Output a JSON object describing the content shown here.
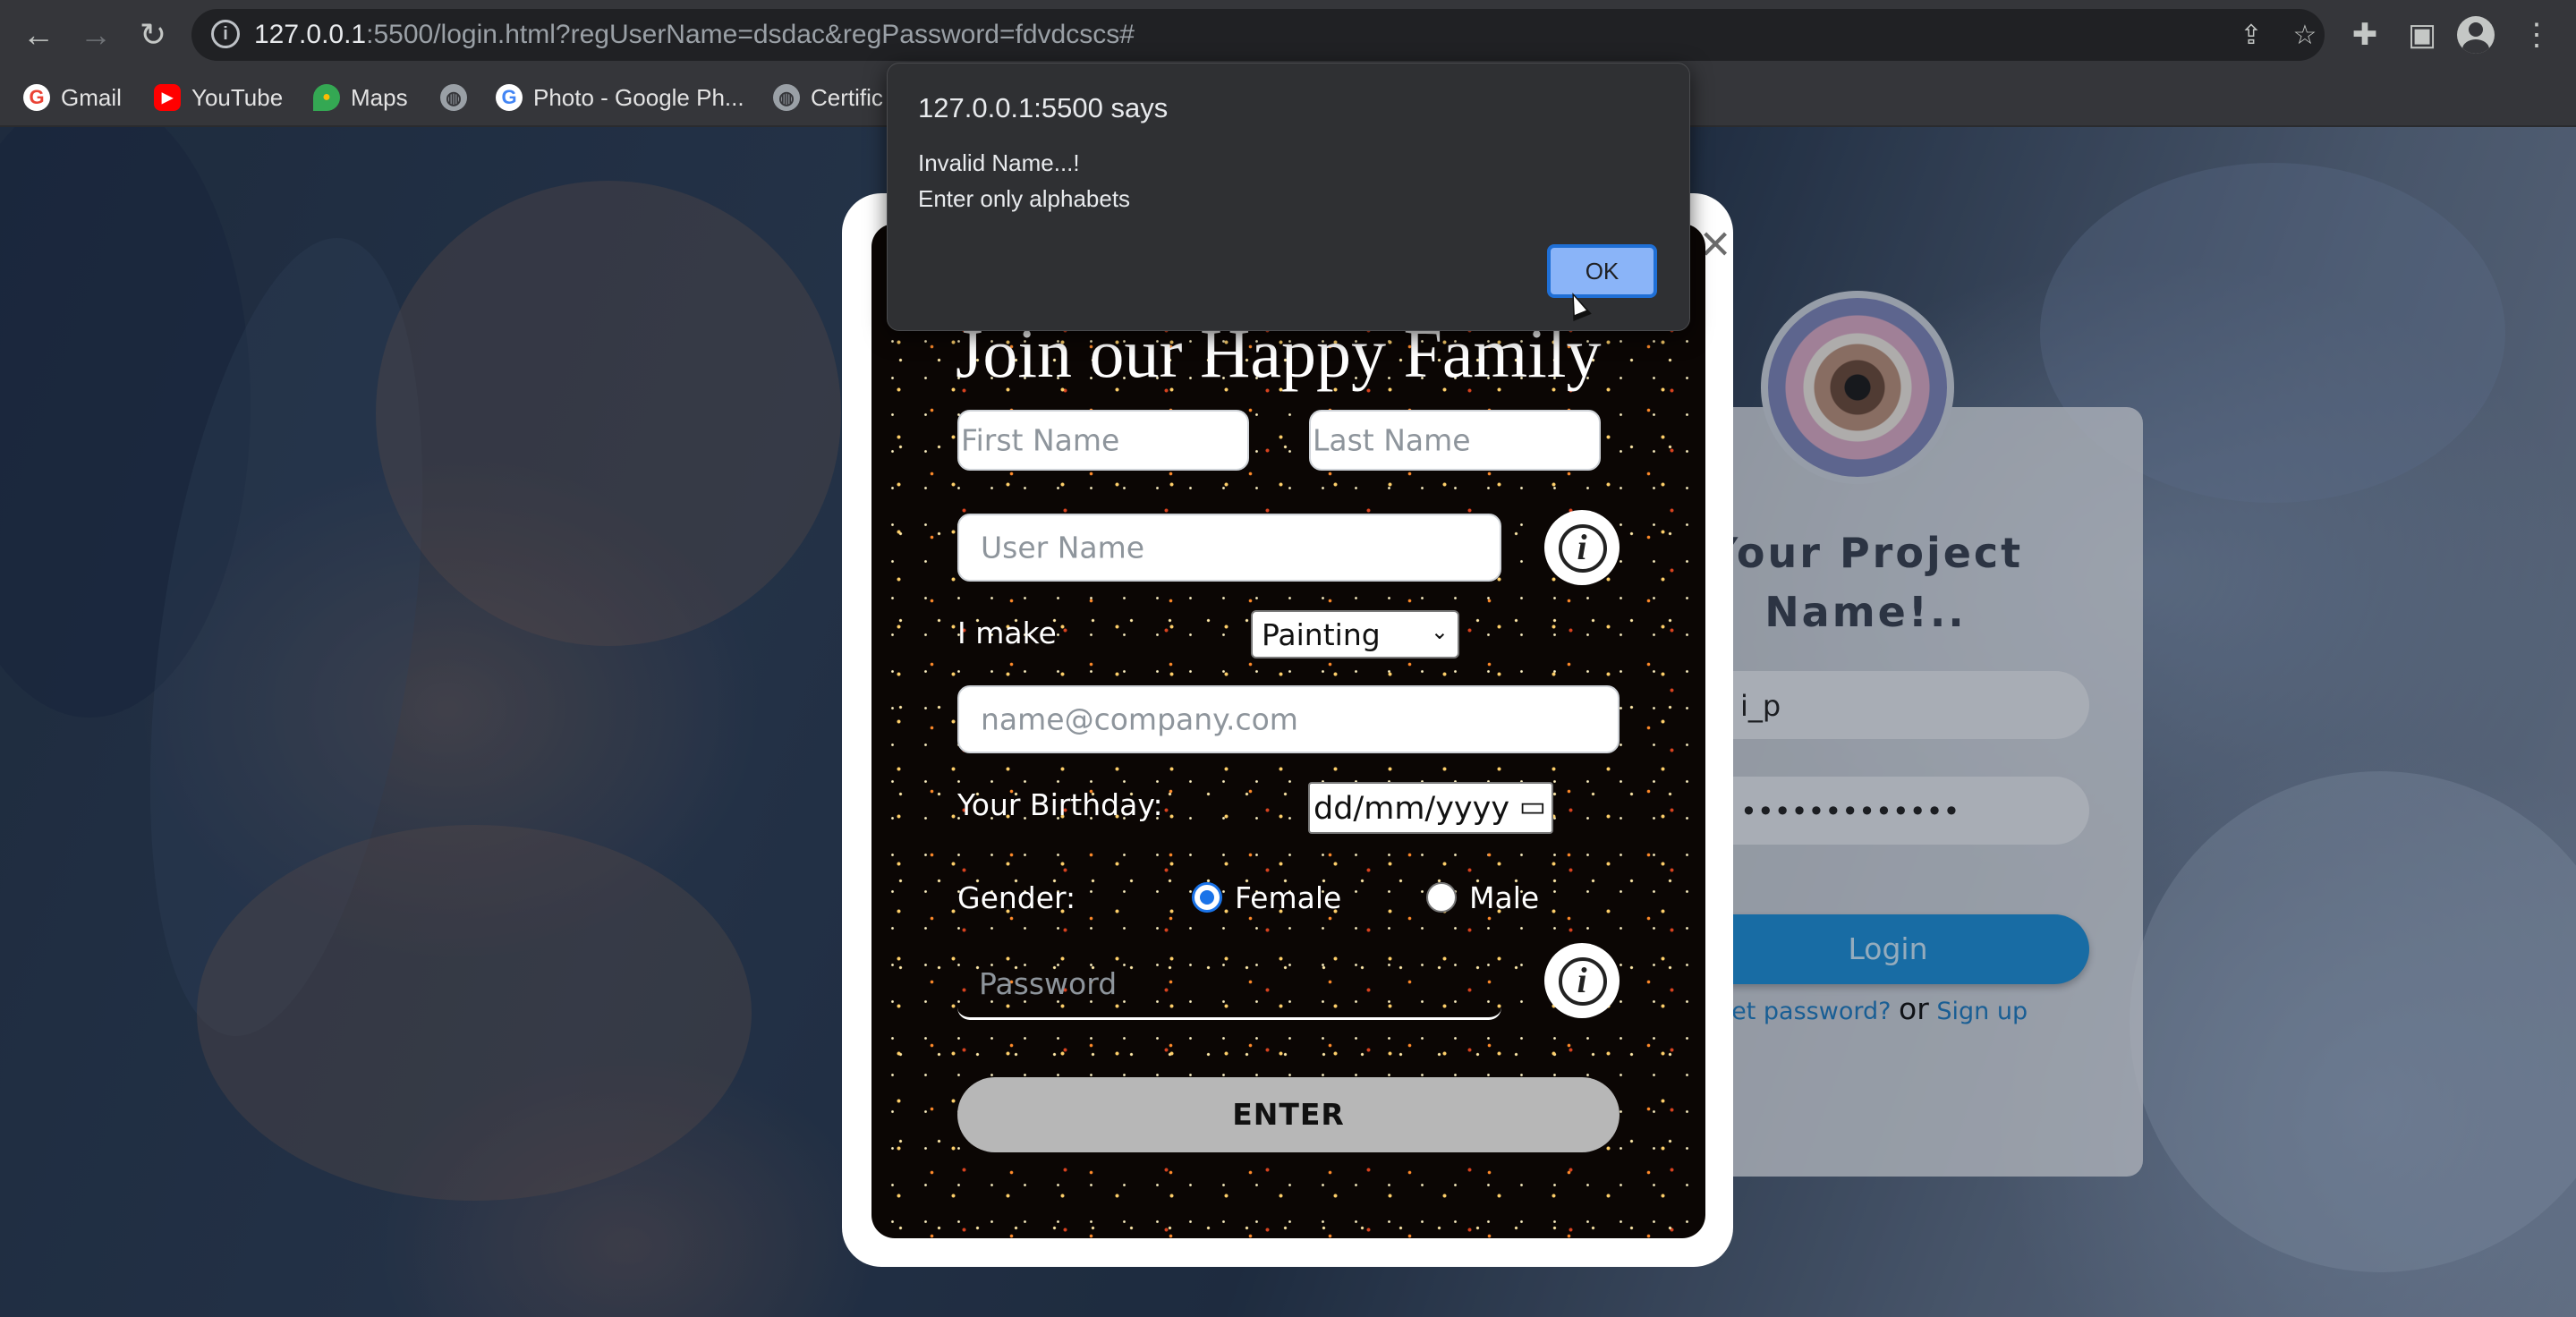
{
  "browser": {
    "url_host": "127.0.0.1",
    "url_rest": ":5500/login.html?regUserName=dsdac&regPassword=fdvdcscs#",
    "bookmarks": [
      {
        "label": "Gmail",
        "icon": "gmail-icon"
      },
      {
        "label": "YouTube",
        "icon": "youtube-icon"
      },
      {
        "label": "Maps",
        "icon": "maps-icon"
      },
      {
        "label": "",
        "icon": "globe-icon"
      },
      {
        "label": "Photo - Google Ph...",
        "icon": "google-icon"
      },
      {
        "label": "Certific",
        "icon": "globe-icon"
      }
    ]
  },
  "alert": {
    "title": "127.0.0.1:5500 says",
    "line1": "Invalid Name...!",
    "line2": "Enter only alphabets",
    "ok_label": "OK"
  },
  "register": {
    "title": "Join our Happy Family",
    "first_name_placeholder": "First Name",
    "last_name_placeholder": "Last Name",
    "username_placeholder": "User Name",
    "i_make_label": "I make",
    "i_make_value": "Painting",
    "email_placeholder": "name@company.com",
    "birthday_label": "Your Birthday:",
    "birthday_value": "dd/mm/yyyy",
    "gender_label": "Gender:",
    "gender_female": "Female",
    "gender_male": "Male",
    "gender_selected": "Female",
    "password_placeholder": "Password",
    "enter_label": "ENTER",
    "close_symbol": "×",
    "info_symbol": "i"
  },
  "login": {
    "project_name_line1": "Your Project",
    "project_name_line2": "Name!..",
    "username_value": "i_p",
    "password_value": "•••••••••••••",
    "login_label": "Login",
    "forgot_label": "get password?",
    "or_label": "or",
    "signup_label": "Sign up"
  },
  "colors": {
    "accent_blue": "#1c8ed6",
    "alert_ok": "#8ab4f8",
    "radio_selected": "#1a73e8"
  }
}
